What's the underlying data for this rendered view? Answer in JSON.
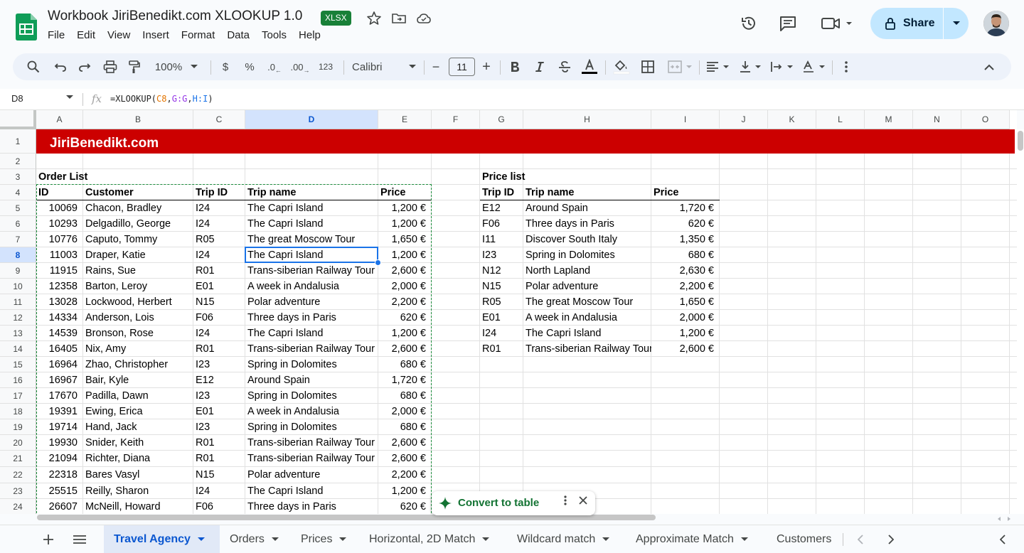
{
  "doc": {
    "title": "Workbook JiriBenedikt.com XLOOKUP 1.0",
    "badge": "XLSX"
  },
  "menu": [
    "File",
    "Edit",
    "View",
    "Insert",
    "Format",
    "Data",
    "Tools",
    "Help"
  ],
  "share": {
    "label": "Share"
  },
  "toolbar": {
    "zoom": "100%",
    "currency": "$",
    "percent": "%",
    "dec_decrease": ".0",
    "dec_increase": ".00",
    "number_format": "123",
    "font": "Calibri",
    "font_size": "11",
    "minus": "−",
    "plus": "+"
  },
  "formula_bar": {
    "name_box": "D8",
    "fx": "fx",
    "formula_prefix": "=XLOOKUP(",
    "ref1": "C8",
    "comma1": ",",
    "ref2": "G:G",
    "comma2": ",",
    "ref3": "H:I",
    "formula_suffix": ")"
  },
  "columns": [
    "A",
    "B",
    "C",
    "D",
    "E",
    "F",
    "G",
    "H",
    "I",
    "J",
    "K",
    "L",
    "M",
    "N",
    "O"
  ],
  "selected_column": "D",
  "rows": [
    "1",
    "2",
    "3",
    "4",
    "5",
    "6",
    "7",
    "8",
    "9",
    "10",
    "11",
    "12",
    "13",
    "14",
    "15",
    "16",
    "17",
    "18",
    "19",
    "20",
    "21",
    "22",
    "23",
    "24"
  ],
  "selected_row": "8",
  "banner": "JiriBenedikt.com",
  "order_list": {
    "title": "Order List",
    "headers": [
      "ID",
      "Customer",
      "Trip ID",
      "Trip name",
      "Price"
    ],
    "rows": [
      [
        "10069",
        "Chacon, Bradley",
        "I24",
        "The Capri Island",
        "1,200 €"
      ],
      [
        "10293",
        "Delgadillo, George",
        "I24",
        "The Capri Island",
        "1,200 €"
      ],
      [
        "10776",
        "Caputo, Tommy",
        "R05",
        "The great Moscow Tour",
        "1,650 €"
      ],
      [
        "11003",
        "Draper, Katie",
        "I24",
        "The Capri Island",
        "1,200 €"
      ],
      [
        "11915",
        "Rains, Sue",
        "R01",
        "Trans-siberian Railway Tour",
        "2,600 €"
      ],
      [
        "12358",
        "Barton, Leroy",
        "E01",
        "A week in Andalusia",
        "2,000 €"
      ],
      [
        "13028",
        "Lockwood, Herbert",
        "N15",
        "Polar adventure",
        "2,200 €"
      ],
      [
        "14334",
        "Anderson, Lois",
        "F06",
        "Three days in Paris",
        "620 €"
      ],
      [
        "14539",
        "Bronson, Rose",
        "I24",
        "The Capri Island",
        "1,200 €"
      ],
      [
        "16405",
        "Nix, Amy",
        "R01",
        "Trans-siberian Railway Tour",
        "2,600 €"
      ],
      [
        "16964",
        "Zhao, Christopher",
        "I23",
        "Spring in Dolomites",
        "680 €"
      ],
      [
        "16967",
        "Bair, Kyle",
        "E12",
        "Around Spain",
        "1,720 €"
      ],
      [
        "17670",
        "Padilla, Dawn",
        "I23",
        "Spring in Dolomites",
        "680 €"
      ],
      [
        "19391",
        "Ewing, Erica",
        "E01",
        "A week in Andalusia",
        "2,000 €"
      ],
      [
        "19714",
        "Hand, Jack",
        "I23",
        "Spring in Dolomites",
        "680 €"
      ],
      [
        "19930",
        "Snider, Keith",
        "R01",
        "Trans-siberian Railway Tour",
        "2,600 €"
      ],
      [
        "21094",
        "Richter, Diana",
        "R01",
        "Trans-siberian Railway Tour",
        "2,600 €"
      ],
      [
        "22318",
        "Bares Vasyl",
        "N15",
        "Polar adventure",
        "2,200 €"
      ],
      [
        "25515",
        "Reilly, Sharon",
        "I24",
        "The Capri Island",
        "1,200 €"
      ],
      [
        "26607",
        "McNeill, Howard",
        "F06",
        "Three days in Paris",
        "620 €"
      ]
    ]
  },
  "price_list": {
    "title": "Price list",
    "headers": [
      "Trip ID",
      "Trip name",
      "Price"
    ],
    "rows": [
      [
        "E12",
        "Around Spain",
        "1,720 €"
      ],
      [
        "F06",
        "Three days in Paris",
        "620 €"
      ],
      [
        "I11",
        "Discover South Italy",
        "1,350 €"
      ],
      [
        "I23",
        "Spring in Dolomites",
        "680 €"
      ],
      [
        "N12",
        "North Lapland",
        "2,630 €"
      ],
      [
        "N15",
        "Polar adventure",
        "2,200 €"
      ],
      [
        "R05",
        "The great Moscow Tour",
        "1,650 €"
      ],
      [
        "E01",
        "A week in Andalusia",
        "2,000 €"
      ],
      [
        "I24",
        "The Capri Island",
        "1,200 €"
      ],
      [
        "R01",
        "Trans-siberian Railway Tour",
        "2,600 €"
      ]
    ]
  },
  "convert_popup": {
    "label": "Convert to table"
  },
  "sheets": [
    {
      "name": "Travel Agency",
      "active": true
    },
    {
      "name": "Orders",
      "active": false
    },
    {
      "name": "Prices",
      "active": false
    },
    {
      "name": "Horizontal, 2D Match",
      "active": false
    },
    {
      "name": "Wildcard match",
      "active": false
    },
    {
      "name": "Approximate Match",
      "active": false
    },
    {
      "name": "Customers",
      "active": false
    }
  ],
  "colors": {
    "banner": "#cc0000",
    "selection": "#1a73e8",
    "share_bg": "#c2e7ff",
    "badge_bg": "#188038",
    "copy_border": "#1e8e3e"
  }
}
